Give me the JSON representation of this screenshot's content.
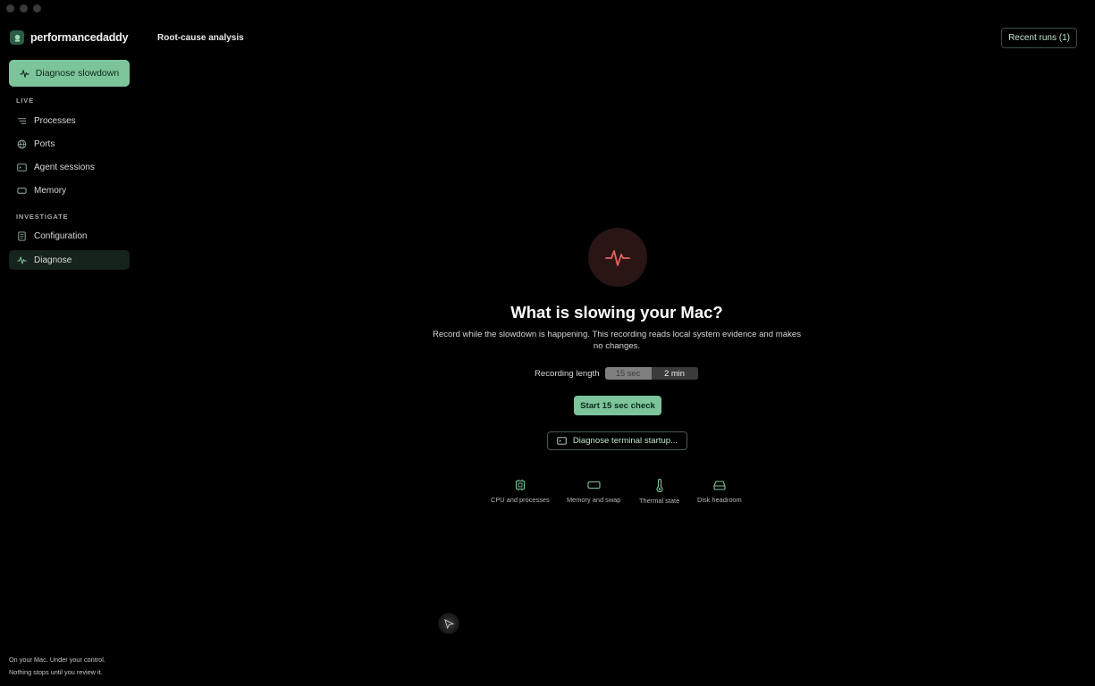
{
  "app": {
    "name": "performancedaddy"
  },
  "sidebar": {
    "primary_action": {
      "label": "Diagnose slowdown",
      "icon": "pulse-icon"
    },
    "sections": [
      {
        "label": "LIVE",
        "items": [
          {
            "label": "Processes",
            "icon": "list-icon"
          },
          {
            "label": "Ports",
            "icon": "globe-icon"
          },
          {
            "label": "Agent sessions",
            "icon": "terminal-icon"
          },
          {
            "label": "Memory",
            "icon": "memory-icon"
          }
        ]
      },
      {
        "label": "INVESTIGATE",
        "items": [
          {
            "label": "Configuration",
            "icon": "document-icon"
          },
          {
            "label": "Diagnose",
            "icon": "pulse-icon",
            "active": true
          }
        ]
      }
    ],
    "footer": {
      "line1": "On your Mac. Under your control.",
      "line2": "Nothing stops until you review it."
    }
  },
  "header": {
    "title": "Root-cause analysis",
    "recent_runs": "Recent runs (1)"
  },
  "main": {
    "headline": "What is slowing your Mac?",
    "subtext": "Record while the slowdown is happening. This recording reads local system evidence and makes no changes.",
    "recording_length": {
      "label": "Recording length",
      "options": [
        "15 sec",
        "2 min"
      ],
      "selected": "2 min"
    },
    "start_button": "Start 15 sec check",
    "terminal_button": "Diagnose terminal startup...",
    "checks": [
      {
        "label": "CPU and processes",
        "icon": "chip-icon"
      },
      {
        "label": "Memory and swap",
        "icon": "memory-icon"
      },
      {
        "label": "Thermal state",
        "icon": "thermometer-icon"
      },
      {
        "label": "Disk headroom",
        "icon": "disk-icon"
      }
    ]
  },
  "colors": {
    "accent": "#7cc49a",
    "background": "#000000",
    "hero_bg": "#2a1515",
    "hero_icon": "#e0645c"
  }
}
